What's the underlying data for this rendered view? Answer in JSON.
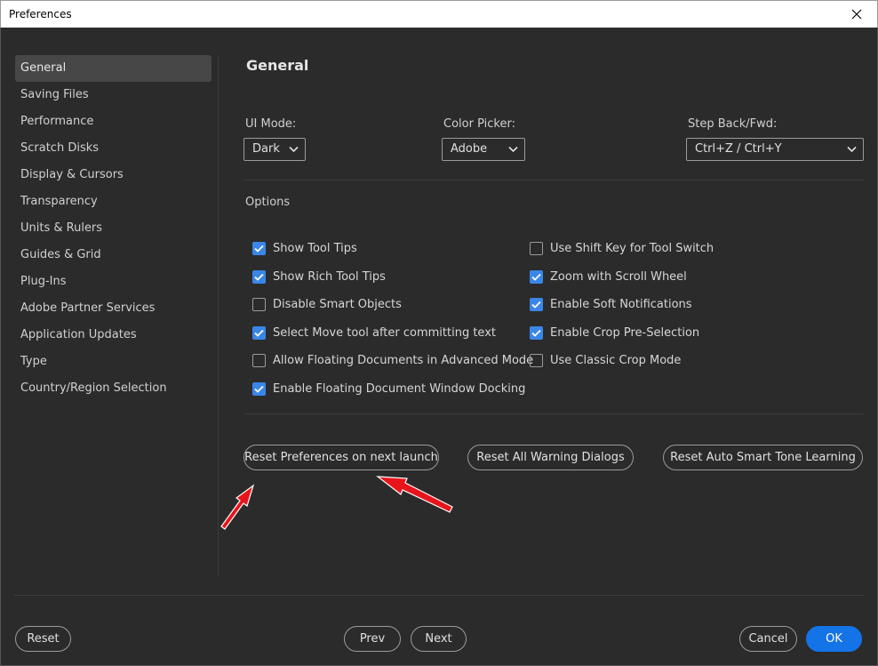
{
  "window": {
    "title": "Preferences",
    "close_icon": "close-icon"
  },
  "sidebar": {
    "items": [
      {
        "label": "General",
        "active": true
      },
      {
        "label": "Saving Files"
      },
      {
        "label": "Performance"
      },
      {
        "label": "Scratch Disks"
      },
      {
        "label": "Display & Cursors"
      },
      {
        "label": "Transparency"
      },
      {
        "label": "Units & Rulers"
      },
      {
        "label": "Guides & Grid"
      },
      {
        "label": "Plug-Ins"
      },
      {
        "label": "Adobe Partner Services"
      },
      {
        "label": "Application Updates"
      },
      {
        "label": "Type"
      },
      {
        "label": "Country/Region Selection"
      }
    ]
  },
  "main": {
    "title": "General",
    "ui_mode": {
      "label": "UI Mode:",
      "value": "Dark"
    },
    "color_picker": {
      "label": "Color Picker:",
      "value": "Adobe"
    },
    "step_back": {
      "label": "Step Back/Fwd:",
      "value": "Ctrl+Z / Ctrl+Y"
    },
    "options_label": "Options",
    "options_left": [
      {
        "label": "Show Tool Tips",
        "checked": true
      },
      {
        "label": "Show Rich Tool Tips",
        "checked": true
      },
      {
        "label": "Disable Smart Objects",
        "checked": false
      },
      {
        "label": "Select Move tool after committing text",
        "checked": true
      },
      {
        "label": "Allow Floating Documents in Advanced Mode",
        "checked": false
      },
      {
        "label": "Enable Floating Document Window Docking",
        "checked": true
      }
    ],
    "options_right": [
      {
        "label": "Use Shift Key for Tool Switch",
        "checked": false
      },
      {
        "label": "Zoom with Scroll Wheel",
        "checked": true
      },
      {
        "label": "Enable Soft Notifications",
        "checked": true
      },
      {
        "label": "Enable Crop Pre-Selection",
        "checked": true
      },
      {
        "label": "Use Classic Crop Mode",
        "checked": false
      }
    ],
    "reset_prefs_label": "Reset Preferences on next launch",
    "reset_warnings_label": "Reset All Warning Dialogs",
    "reset_smart_tone_label": "Reset Auto Smart Tone Learning"
  },
  "footer": {
    "reset_label": "Reset",
    "prev_label": "Prev",
    "next_label": "Next",
    "cancel_label": "Cancel",
    "ok_label": "OK"
  },
  "colors": {
    "accent": "#1473e6",
    "checkbox": "#3a86e8",
    "annotation_arrow": "#e8141c",
    "background": "#2b2b2b"
  }
}
